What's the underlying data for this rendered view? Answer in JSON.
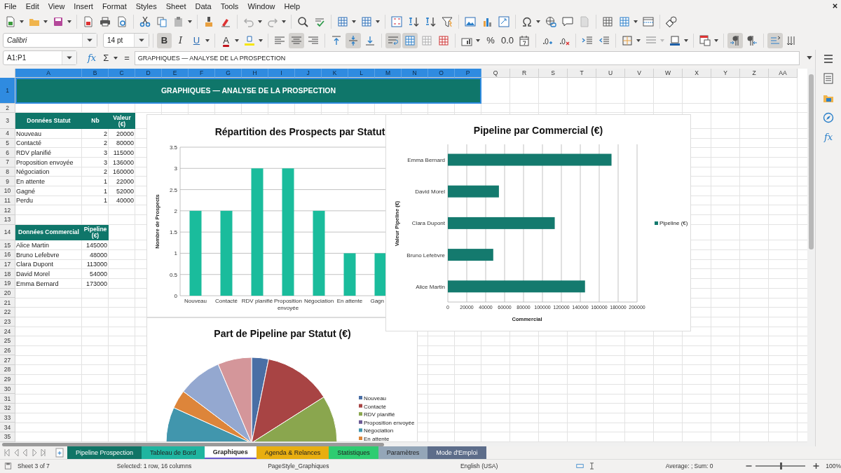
{
  "menu": [
    "File",
    "Edit",
    "View",
    "Insert",
    "Format",
    "Styles",
    "Sheet",
    "Data",
    "Tools",
    "Window",
    "Help"
  ],
  "font_toolbar": {
    "font_name": "Calibri",
    "font_size": "14 pt",
    "styles": [
      {
        "kind": "bold",
        "label": "B",
        "on": true
      },
      {
        "kind": "italic",
        "label": "I",
        "on": false
      },
      {
        "kind": "underline",
        "label": "U",
        "on": false
      }
    ],
    "font_color": "A",
    "alignment": [
      {
        "kind": "left",
        "on": false
      },
      {
        "kind": "center",
        "on": true
      },
      {
        "kind": "right",
        "on": false
      },
      {
        "kind": "top",
        "on": false
      },
      {
        "kind": "middle",
        "on": true
      },
      {
        "kind": "bottom",
        "on": false
      },
      {
        "kind": "wrap",
        "on": true
      },
      {
        "kind": "merge_center",
        "on": true
      },
      {
        "kind": "merge",
        "on": false
      },
      {
        "kind": "unmerge",
        "on": false
      }
    ],
    "percent": "%",
    "decimal": "0.0",
    "direction": [
      {
        "kind": "ltr",
        "on": true
      },
      {
        "kind": "rtl",
        "on": false
      },
      {
        "kind": "horizontal",
        "on": true
      },
      {
        "kind": "vertical",
        "on": false
      }
    ]
  },
  "formula_bar": {
    "name_box": "A1:P1",
    "function_wizard": "fx",
    "sum": "Σ",
    "equals": "=",
    "content": "GRAPHIQUES — ANALYSE DE LA PROSPECTION"
  },
  "columns": [
    {
      "label": "A",
      "selected": true
    },
    {
      "label": "B",
      "selected": true
    },
    {
      "label": "C",
      "selected": true
    },
    {
      "label": "D",
      "selected": true
    },
    {
      "label": "E",
      "selected": true
    },
    {
      "label": "F",
      "selected": true
    },
    {
      "label": "G",
      "selected": true
    },
    {
      "label": "H",
      "selected": true
    },
    {
      "label": "I",
      "selected": true
    },
    {
      "label": "J",
      "selected": true
    },
    {
      "label": "K",
      "selected": true
    },
    {
      "label": "L",
      "selected": true
    },
    {
      "label": "M",
      "selected": true
    },
    {
      "label": "N",
      "selected": true
    },
    {
      "label": "O",
      "selected": true
    },
    {
      "label": "P",
      "selected": true
    },
    {
      "label": "Q",
      "selected": false
    },
    {
      "label": "R",
      "selected": false
    },
    {
      "label": "S",
      "selected": false
    },
    {
      "label": "T",
      "selected": false
    },
    {
      "label": "U",
      "selected": false
    },
    {
      "label": "V",
      "selected": false
    },
    {
      "label": "W",
      "selected": false
    },
    {
      "label": "X",
      "selected": false
    },
    {
      "label": "Y",
      "selected": false
    },
    {
      "label": "Z",
      "selected": false
    },
    {
      "label": "AA",
      "selected": false
    }
  ],
  "rows": [
    {
      "number": "1",
      "selected": true,
      "kind": "title",
      "cells": [
        "GRAPHIQUES — ANALYSE DE LA PROSPECTION"
      ]
    },
    {
      "number": "2",
      "selected": false,
      "kind": "blank"
    },
    {
      "number": "3",
      "selected": false,
      "kind": "header",
      "cells": [
        "Données Statut",
        "Nb",
        "Valeur (€)"
      ]
    },
    {
      "number": "4",
      "selected": false,
      "kind": "data",
      "cells": [
        "Nouveau",
        "2",
        "20000"
      ]
    },
    {
      "number": "5",
      "selected": false,
      "kind": "data",
      "cells": [
        "Contacté",
        "2",
        "80000"
      ]
    },
    {
      "number": "6",
      "selected": false,
      "kind": "data",
      "cells": [
        "RDV planifié",
        "3",
        "115000"
      ]
    },
    {
      "number": "7",
      "selected": false,
      "kind": "data",
      "cells": [
        "Proposition envoyée",
        "3",
        "136000"
      ]
    },
    {
      "number": "8",
      "selected": false,
      "kind": "data",
      "cells": [
        "Négociation",
        "2",
        "160000"
      ]
    },
    {
      "number": "9",
      "selected": false,
      "kind": "data",
      "cells": [
        "En attente",
        "1",
        "22000"
      ]
    },
    {
      "number": "10",
      "selected": false,
      "kind": "data",
      "cells": [
        "Gagné",
        "1",
        "52000"
      ]
    },
    {
      "number": "11",
      "selected": false,
      "kind": "data",
      "cells": [
        "Perdu",
        "1",
        "40000"
      ]
    },
    {
      "number": "12",
      "selected": false,
      "kind": "blank"
    },
    {
      "number": "13",
      "selected": false,
      "kind": "blank"
    },
    {
      "number": "14",
      "selected": false,
      "kind": "header",
      "cells": [
        "Données Commercial",
        "Pipeline (€)"
      ]
    },
    {
      "number": "15",
      "selected": false,
      "kind": "data",
      "cells": [
        "Alice Martin",
        "145000"
      ]
    },
    {
      "number": "16",
      "selected": false,
      "kind": "data",
      "cells": [
        "Bruno Lefebvre",
        "48000"
      ]
    },
    {
      "number": "17",
      "selected": false,
      "kind": "data",
      "cells": [
        "Clara Dupont",
        "113000"
      ]
    },
    {
      "number": "18",
      "selected": false,
      "kind": "data",
      "cells": [
        "David Morel",
        "54000"
      ]
    },
    {
      "number": "19",
      "selected": false,
      "kind": "data",
      "cells": [
        "Emma Bernard",
        "173000"
      ]
    },
    {
      "number": "20",
      "selected": false,
      "kind": "blank"
    },
    {
      "number": "21",
      "selected": false,
      "kind": "blank"
    },
    {
      "number": "22",
      "selected": false,
      "kind": "blank"
    },
    {
      "number": "23",
      "selected": false,
      "kind": "blank"
    },
    {
      "number": "24",
      "selected": false,
      "kind": "blank"
    },
    {
      "number": "25",
      "selected": false,
      "kind": "blank"
    },
    {
      "number": "26",
      "selected": false,
      "kind": "blank"
    },
    {
      "number": "27",
      "selected": false,
      "kind": "blank"
    },
    {
      "number": "28",
      "selected": false,
      "kind": "blank"
    },
    {
      "number": "29",
      "selected": false,
      "kind": "blank"
    },
    {
      "number": "30",
      "selected": false,
      "kind": "blank"
    },
    {
      "number": "31",
      "selected": false,
      "kind": "blank"
    },
    {
      "number": "32",
      "selected": false,
      "kind": "blank"
    },
    {
      "number": "33",
      "selected": false,
      "kind": "blank"
    },
    {
      "number": "34",
      "selected": false,
      "kind": "blank"
    },
    {
      "number": "35",
      "selected": false,
      "kind": "blank"
    }
  ],
  "status_chart": {
    "chart_data": {
      "type": "bar",
      "title": "Répartition des Prospects par Statut",
      "ylabel": "Nombre de Prospects",
      "categories": [
        "Nouveau",
        "Contacté",
        "RDV planifié",
        "Proposition envoyée",
        "Négociation",
        "En attente",
        "Gagn"
      ],
      "series": [
        {
          "color": "#1abc9c",
          "values": [
            2,
            2,
            3,
            3,
            2,
            1,
            1
          ]
        }
      ],
      "ylim": [
        0,
        3.5
      ],
      "yticks": [
        0,
        0.5,
        1,
        1.5,
        2,
        2.5,
        3,
        3.5
      ],
      "grid": true
    }
  },
  "commercial_chart": {
    "chart_data": {
      "type": "bar",
      "orientation": "horizontal",
      "title": "Pipeline par Commercial (€)",
      "xlabel": "Commercial",
      "ylabel": "Valeur Pipeline (€)",
      "categories": [
        "Emma Bernard",
        "David Morel",
        "Clara Dupont",
        "Bruno Lefebvre",
        "Alice Martin"
      ],
      "series": [
        {
          "name": "Pipeline (€)",
          "color": "#147a6e",
          "values": [
            173000,
            54000,
            113000,
            48000,
            145000
          ]
        }
      ],
      "xlim": [
        0,
        200000
      ],
      "xticks": [
        0,
        20000,
        40000,
        60000,
        80000,
        100000,
        120000,
        140000,
        160000,
        180000,
        200000
      ],
      "grid": true
    }
  },
  "pie_chart": {
    "title": "Part de Pipeline par Statut (€)",
    "legend": [
      {
        "label": "Nouveau",
        "color": "#4a6fa5"
      },
      {
        "label": "Contacté",
        "color": "#a84444"
      },
      {
        "label": "RDV planifié",
        "color": "#8aa64e"
      },
      {
        "label": "Proposition envoyée",
        "color": "#6b5a94"
      },
      {
        "label": "Négociation",
        "color": "#4196ad"
      },
      {
        "label": "En attente",
        "color": "#dd853a"
      }
    ]
  },
  "sidebar": {
    "functions": "fx"
  },
  "sheet_tabs": [
    {
      "label": "Pipeline Prospection",
      "color": "#107566",
      "selected": false
    },
    {
      "label": "Tableau de Bord",
      "color": "#1fb5a0",
      "selected": false
    },
    {
      "label": "Graphiques",
      "color": "#6a5acd",
      "selected": true
    },
    {
      "label": "Agenda & Relances",
      "color": "#e8ae10",
      "selected": false
    },
    {
      "label": "Statistiques",
      "color": "#2ecc71",
      "selected": false
    },
    {
      "label": "Paramètres",
      "color": "#94a6b8",
      "selected": false
    },
    {
      "label": "Mode d'Emploi",
      "color": "#5d6d8a",
      "selected": false
    }
  ],
  "status_bar": {
    "sheet": "Sheet 3 of 7",
    "selection": "Selected: 1 row, 16 columns",
    "page_style": "PageStyle_Graphiques",
    "language": "English (USA)",
    "summary": "Average: ; Sum: 0",
    "zoom": {
      "level": 0.5,
      "reading": "100%"
    }
  }
}
